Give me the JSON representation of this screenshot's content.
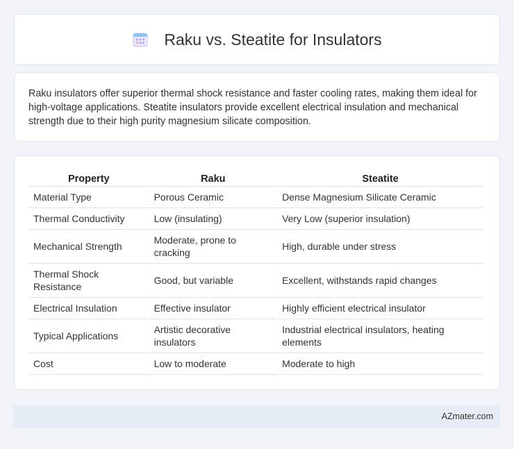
{
  "header": {
    "title": "Raku vs. Steatite for Insulators",
    "icon": "calendar-icon"
  },
  "intro": {
    "text": "Raku insulators offer superior thermal shock resistance and faster cooling rates, making them ideal for high-voltage applications. Steatite insulators provide excellent electrical insulation and mechanical strength due to their high purity magnesium silicate composition."
  },
  "table": {
    "headers": [
      "Property",
      "Raku",
      "Steatite"
    ],
    "rows": [
      [
        "Material Type",
        "Porous Ceramic",
        "Dense Magnesium Silicate Ceramic"
      ],
      [
        "Thermal Conductivity",
        "Low (insulating)",
        "Very Low (superior insulation)"
      ],
      [
        "Mechanical Strength",
        "Moderate, prone to cracking",
        "High, durable under stress"
      ],
      [
        "Thermal Shock Resistance",
        "Good, but variable",
        "Excellent, withstands rapid changes"
      ],
      [
        "Electrical Insulation",
        "Effective insulator",
        "Highly efficient electrical insulator"
      ],
      [
        "Typical Applications",
        "Artistic decorative insulators",
        "Industrial electrical insulators, heating elements"
      ],
      [
        "Cost",
        "Low to moderate",
        "Moderate to high"
      ]
    ]
  },
  "footer": {
    "source": "AZmater.com"
  },
  "colors": {
    "page_background": "#f1f4f9",
    "card_background": "#ffffff",
    "footer_background": "#e6edf7",
    "icon_accent": "#8b83e6"
  }
}
